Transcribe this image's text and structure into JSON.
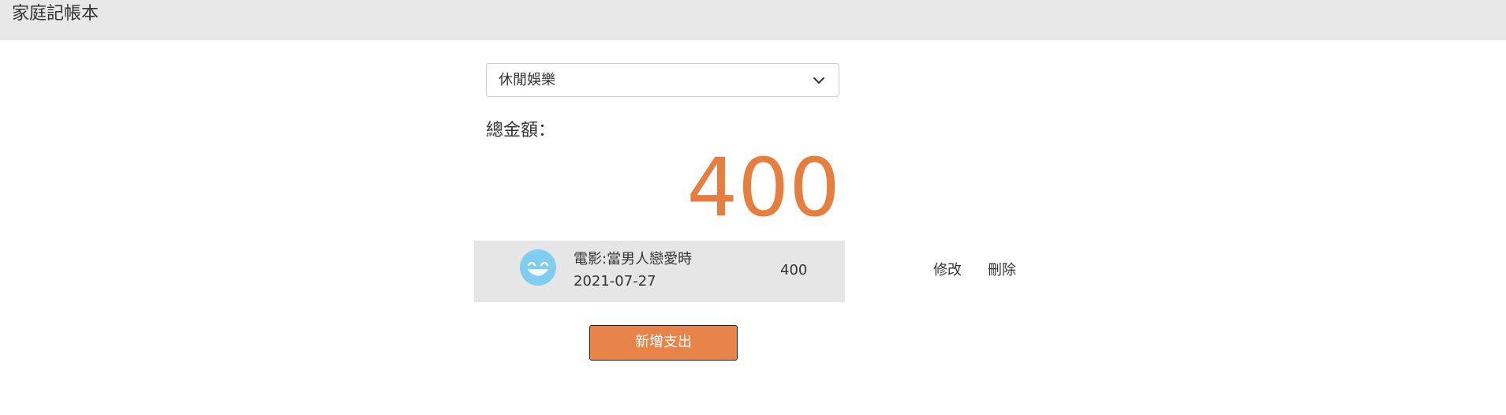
{
  "header": {
    "title": "家庭記帳本"
  },
  "category_select": {
    "selected": "休閒娛樂"
  },
  "summary": {
    "total_label": "總金額：",
    "total_amount": "400"
  },
  "expenses": [
    {
      "icon": "grinning-face-icon",
      "name": "電影:當男人戀愛時",
      "date": "2021-07-27",
      "amount": "400",
      "edit_label": "修改",
      "delete_label": "刪除"
    }
  ],
  "actions": {
    "add_expense_label": "新增支出"
  },
  "colors": {
    "topbar_bg": "#e8e8e8",
    "accent": "#e67e3f",
    "button_bg": "#e8844a",
    "row_bg": "#e6e6e6",
    "emoji": "#7fcdf0"
  }
}
